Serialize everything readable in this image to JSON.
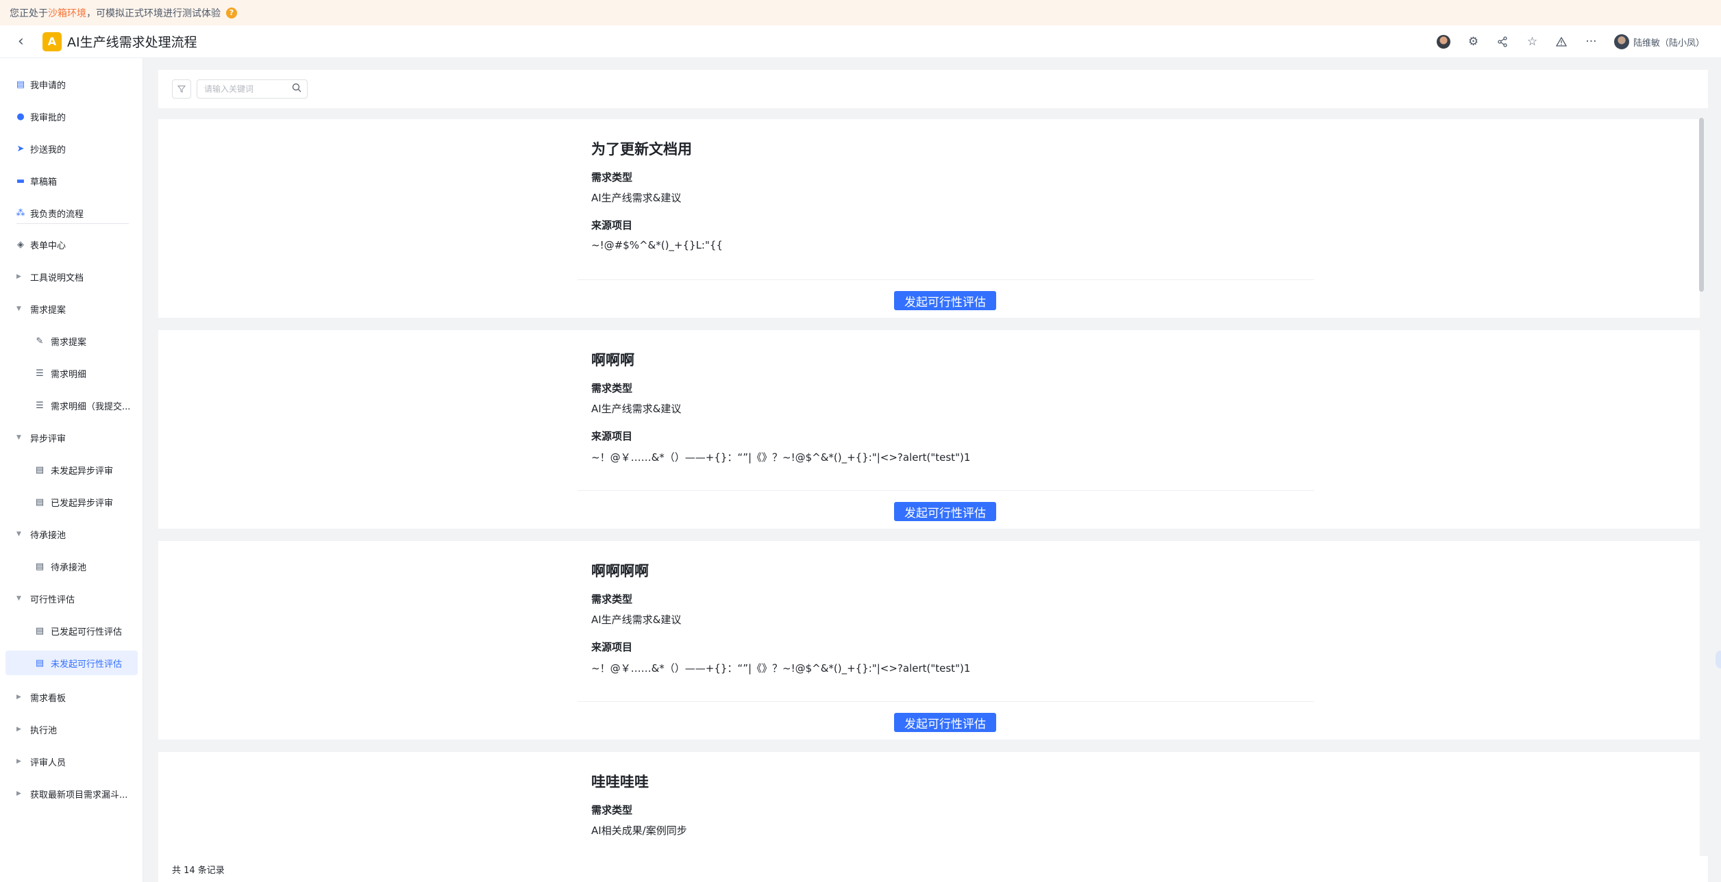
{
  "banner": {
    "prefix": "您正处于",
    "highlight": "沙箱环境",
    "suffix": "，可模拟正式环境进行测试体验",
    "help_icon": "?"
  },
  "header": {
    "app_logo_letter": "A",
    "title": "AI生产线需求处理流程",
    "user_name": "陆维敏（陆小凤）"
  },
  "sidebar": {
    "items": [
      {
        "label": "我申请的",
        "icon": "document-icon"
      },
      {
        "label": "我审批的",
        "icon": "user-icon"
      },
      {
        "label": "抄送我的",
        "icon": "send-icon"
      },
      {
        "label": "草稿箱",
        "icon": "draft-icon"
      },
      {
        "label": "我负责的流程",
        "icon": "flow-icon"
      }
    ],
    "form_center": "表单中心",
    "groups": [
      {
        "label": "工具说明文档",
        "expanded": false
      },
      {
        "label": "需求提案",
        "expanded": true,
        "children": [
          "需求提案",
          "需求明细",
          "需求明细（我提交..."
        ]
      },
      {
        "label": "异步评审",
        "expanded": true,
        "children": [
          "未发起异步评审",
          "已发起异步评审"
        ]
      },
      {
        "label": "待承接池",
        "expanded": true,
        "children": [
          "待承接池"
        ]
      },
      {
        "label": "可行性评估",
        "expanded": true,
        "children": [
          "已发起可行性评估",
          "未发起可行性评估"
        ]
      },
      {
        "label": "需求看板",
        "expanded": false
      },
      {
        "label": "执行池",
        "expanded": false
      },
      {
        "label": "评审人员",
        "expanded": false
      },
      {
        "label": "获取最新项目需求漏斗...",
        "expanded": false
      }
    ]
  },
  "toolbar": {
    "search_placeholder": "请输入关键词"
  },
  "records": [
    {
      "title": "为了更新文档用",
      "type_label": "需求类型",
      "type_value": "AI生产线需求&建议",
      "source_label": "来源项目",
      "source_value": "~!@#$%^&*()_+{}L:\"{{",
      "action": "发起可行性评估"
    },
    {
      "title": "啊啊啊",
      "type_label": "需求类型",
      "type_value": "AI生产线需求&建议",
      "source_label": "来源项目",
      "source_value": "~！@￥……&*（）——+{}：“”|《》？~!@$^&*()_+{}:\"|<>?alert(\"test\")1",
      "action": "发起可行性评估"
    },
    {
      "title": "啊啊啊啊",
      "type_label": "需求类型",
      "type_value": "AI生产线需求&建议",
      "source_label": "来源项目",
      "source_value": "~！@￥……&*（）——+{}：“”|《》？~!@$^&*()_+{}:\"|<>?alert(\"test\")1",
      "action": "发起可行性评估"
    },
    {
      "title": "哇哇哇哇",
      "type_label": "需求类型",
      "type_value": "AI相关成果/案例同步"
    }
  ],
  "footer": {
    "total": "共 14 条记录"
  }
}
